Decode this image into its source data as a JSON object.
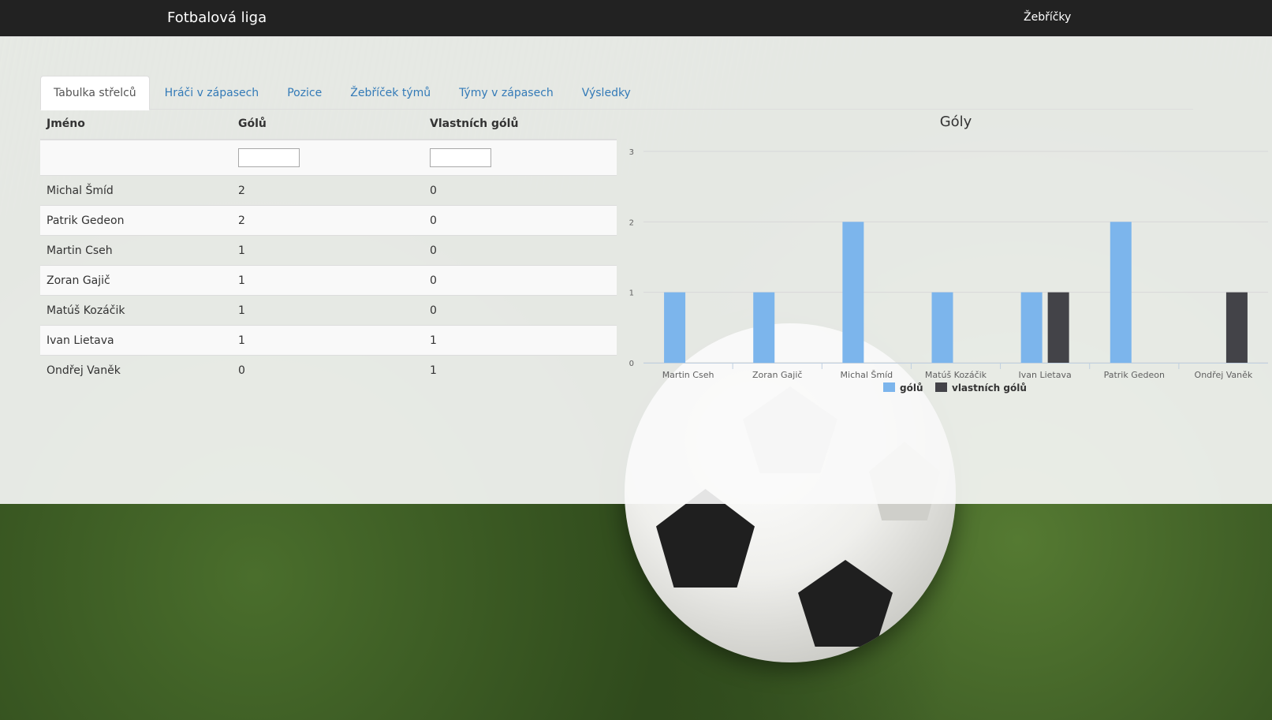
{
  "navbar": {
    "brand": "Fotbalová liga",
    "link": "Žebříčky"
  },
  "tabs": [
    {
      "label": "Tabulka střelců",
      "active": true
    },
    {
      "label": "Hráči v zápasech",
      "active": false
    },
    {
      "label": "Pozice",
      "active": false
    },
    {
      "label": "Žebříček týmů",
      "active": false
    },
    {
      "label": "Týmy v zápasech",
      "active": false
    },
    {
      "label": "Výsledky",
      "active": false
    }
  ],
  "table": {
    "headers": [
      "Jméno",
      "Gólů",
      "Vlastních gólů"
    ],
    "filters": {
      "goals": "",
      "own_goals": ""
    },
    "rows": [
      {
        "name": "Michal Šmíd",
        "goals": "2",
        "own": "0"
      },
      {
        "name": "Patrik Gedeon",
        "goals": "2",
        "own": "0"
      },
      {
        "name": "Martin Cseh",
        "goals": "1",
        "own": "0"
      },
      {
        "name": "Zoran Gajič",
        "goals": "1",
        "own": "0"
      },
      {
        "name": "Matúš Kozáčik",
        "goals": "1",
        "own": "0"
      },
      {
        "name": "Ivan Lietava",
        "goals": "1",
        "own": "1"
      },
      {
        "name": "Ondřej Vaněk",
        "goals": "0",
        "own": "1"
      }
    ]
  },
  "chart_data": {
    "type": "bar",
    "title": "Góly",
    "categories": [
      "Martin Cseh",
      "Zoran Gajič",
      "Michal Šmíd",
      "Matúš Kozáčik",
      "Ivan Lietava",
      "Patrik Gedeon",
      "Ondřej Vaněk"
    ],
    "series": [
      {
        "name": "gólů",
        "color": "#7cb5ec",
        "values": [
          1,
          1,
          2,
          1,
          1,
          2,
          0
        ]
      },
      {
        "name": "vlastních gólů",
        "color": "#434348",
        "values": [
          0,
          0,
          0,
          0,
          1,
          0,
          1
        ]
      }
    ],
    "yticks": [
      0,
      1,
      2,
      3
    ],
    "ylim": [
      0,
      3
    ],
    "legend": "bottom-center",
    "grid": true
  }
}
